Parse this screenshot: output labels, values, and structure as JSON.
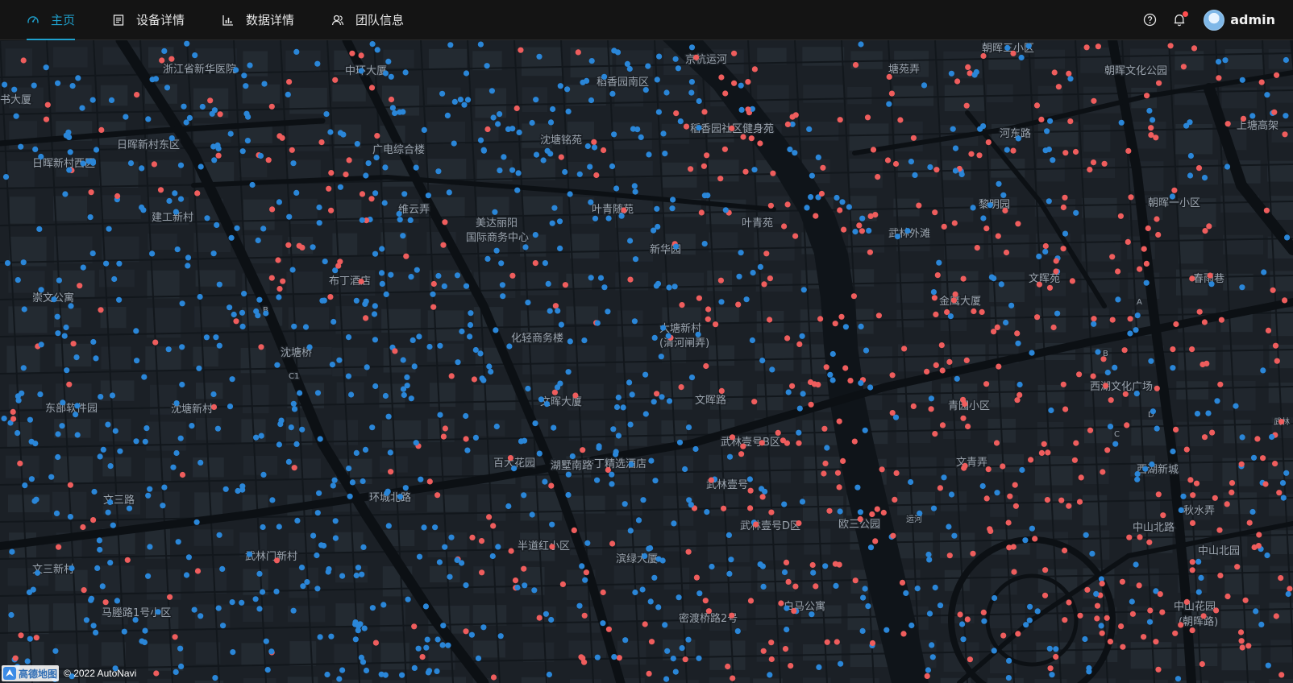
{
  "nav": {
    "items": [
      {
        "label": "主页",
        "icon": "dashboard-icon",
        "active": true
      },
      {
        "label": "设备详情",
        "icon": "device-list-icon",
        "active": false
      },
      {
        "label": "数据详情",
        "icon": "bar-chart-icon",
        "active": false
      },
      {
        "label": "团队信息",
        "icon": "team-icon",
        "active": false
      }
    ]
  },
  "header": {
    "username": "admin",
    "help_icon": "help-icon",
    "bell_icon": "bell-icon",
    "notification_badge": true
  },
  "map": {
    "labels": [
      {
        "text": "浙江省新华医院"
      },
      {
        "text": "中环大厦"
      },
      {
        "text": "稻香园南区"
      },
      {
        "text": "京杭运河"
      },
      {
        "text": "塘苑弄"
      },
      {
        "text": "朝晖三小区"
      },
      {
        "text": "朝晖文化公园"
      },
      {
        "text": "书大厦"
      },
      {
        "text": "日晖新村东区"
      },
      {
        "text": "广电综合楼"
      },
      {
        "text": "沈塘铭苑"
      },
      {
        "text": "稻香园社区健身苑"
      },
      {
        "text": "河东路"
      },
      {
        "text": "上塘高架"
      },
      {
        "text": "日晖新村西区"
      },
      {
        "text": "建工新村"
      },
      {
        "text": "维云弄"
      },
      {
        "text": "美达丽阳"
      },
      {
        "text": "国际商务中心"
      },
      {
        "text": "叶青随苑"
      },
      {
        "text": "叶青苑"
      },
      {
        "text": "武林外滩"
      },
      {
        "text": "黎明园"
      },
      {
        "text": "朝晖一小区"
      },
      {
        "text": "新华园"
      },
      {
        "text": "布丁酒店"
      },
      {
        "text": "崇文公寓"
      },
      {
        "text": "文晖苑"
      },
      {
        "text": "春雨巷"
      },
      {
        "text": "金鹰大厦"
      },
      {
        "text": "大塘新村"
      },
      {
        "text": "(清河闸弄)"
      },
      {
        "text": "化轻商务楼"
      },
      {
        "text": "沈塘桥"
      },
      {
        "text": "文晖大厦"
      },
      {
        "text": "文晖路"
      },
      {
        "text": "西湖文化广场"
      },
      {
        "text": "青园小区"
      },
      {
        "text": "东部软件园"
      },
      {
        "text": "沈塘新村"
      },
      {
        "text": "武林壹号B区"
      },
      {
        "text": "文青弄"
      },
      {
        "text": "百大花园"
      },
      {
        "text": "布丁精选酒店"
      },
      {
        "text": "西湖新城"
      },
      {
        "text": "湖墅南路"
      },
      {
        "text": "武林壹号"
      },
      {
        "text": "环城北路"
      },
      {
        "text": "文三路"
      },
      {
        "text": "秋水弄"
      },
      {
        "text": "武林壹号D区"
      },
      {
        "text": "欧三公园"
      },
      {
        "text": "运河"
      },
      {
        "text": "中山北路"
      },
      {
        "text": "中山北园"
      },
      {
        "text": "半道红小区"
      },
      {
        "text": "滨绿大厦"
      },
      {
        "text": "武林门新村"
      },
      {
        "text": "文三新村"
      },
      {
        "text": "马塍路1号小区"
      },
      {
        "text": "白马公寓"
      },
      {
        "text": "密渡桥路2号"
      },
      {
        "text": "中山花园"
      },
      {
        "text": "(朝晖路)"
      },
      {
        "text": "武林"
      },
      {
        "text": "B"
      },
      {
        "text": "C1"
      },
      {
        "text": "A"
      },
      {
        "text": "B"
      },
      {
        "text": "C"
      },
      {
        "text": "D"
      }
    ],
    "legend_colors": {
      "blue": "#2a86d8",
      "red": "#ef5d5d"
    }
  },
  "attribution": {
    "logo_text": "高德地图",
    "copyright": "© 2022 AutoNavi"
  }
}
